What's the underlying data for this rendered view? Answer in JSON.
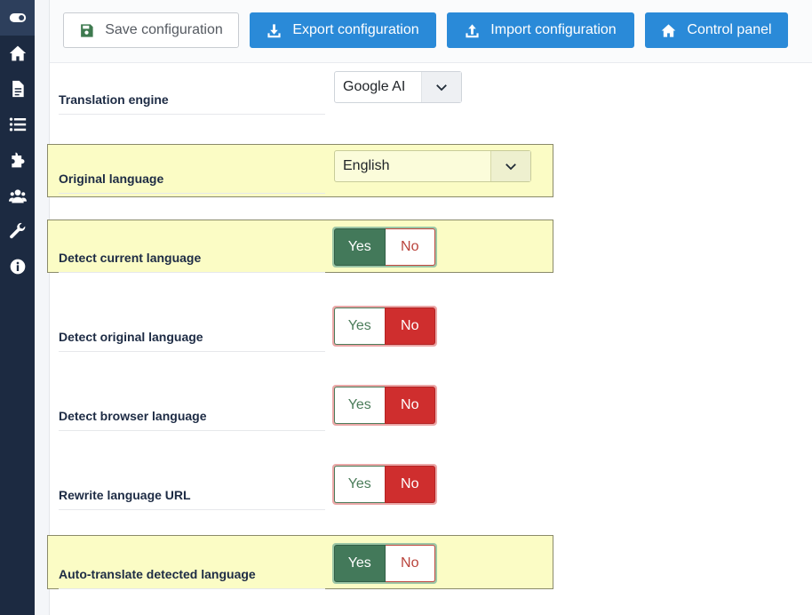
{
  "toolbar": {
    "save_label": "Save configuration",
    "export_label": "Export configuration",
    "import_label": "Import configuration",
    "control_panel_label": "Control panel"
  },
  "sidebar": {
    "items": [
      {
        "icon": "toggle-icon"
      },
      {
        "icon": "home-icon"
      },
      {
        "icon": "document-icon"
      },
      {
        "icon": "list-icon"
      },
      {
        "icon": "puzzle-icon"
      },
      {
        "icon": "users-icon"
      },
      {
        "icon": "wrench-icon"
      },
      {
        "icon": "info-icon"
      }
    ]
  },
  "settings": {
    "translation_engine": {
      "label": "Translation engine",
      "value": "Google AI"
    },
    "original_language": {
      "label": "Original language",
      "value": "English"
    },
    "detect_current_language": {
      "label": "Detect current language",
      "yes": "Yes",
      "no": "No",
      "selected": "yes"
    },
    "detect_original_language": {
      "label": "Detect original language",
      "yes": "Yes",
      "no": "No",
      "selected": "no"
    },
    "detect_browser_language": {
      "label": "Detect browser language",
      "yes": "Yes",
      "no": "No",
      "selected": "no"
    },
    "rewrite_language_url": {
      "label": "Rewrite language URL",
      "yes": "Yes",
      "no": "No",
      "selected": "no"
    },
    "auto_translate_detected_language": {
      "label": "Auto-translate detected language",
      "yes": "Yes",
      "no": "No",
      "selected": "yes"
    }
  },
  "colors": {
    "sidebar": "#1c2a41",
    "primary": "#2a8ad8",
    "yes_active": "#43795a",
    "no_active": "#cf2e2e",
    "highlight": "#fbfcc5"
  }
}
